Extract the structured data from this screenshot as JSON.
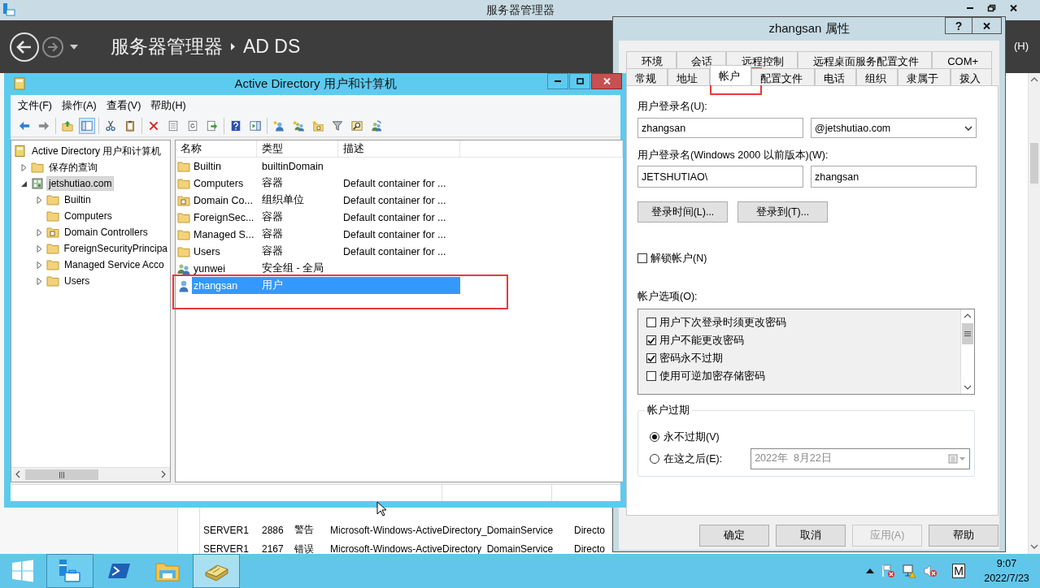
{
  "server_manager": {
    "title": "服务器管理器",
    "breadcrumb": [
      "服务器管理器",
      "AD DS"
    ],
    "menu_fragment": "(H)",
    "event_rows": [
      {
        "cells": [
          "SERVER1",
          "2886",
          "警告",
          "Microsoft-Windows-ActiveDirectory_DomainService",
          "Directo"
        ]
      },
      {
        "cells": [
          "SERVER1",
          "2167",
          "错误",
          "Microsoft-Windows-ActiveDirectory_DomainService",
          "Directo"
        ]
      }
    ]
  },
  "aduc": {
    "title": "Active Directory 用户和计算机",
    "menu": [
      "文件(F)",
      "操作(A)",
      "查看(V)",
      "帮助(H)"
    ],
    "toolbar": [
      [
        {
          "kind": "back",
          "pressed": false
        },
        {
          "kind": "forward",
          "pressed": false
        }
      ],
      [
        {
          "kind": "up",
          "pressed": false
        },
        {
          "kind": "tree",
          "pressed": true
        }
      ],
      [
        {
          "kind": "cut",
          "pressed": false
        },
        {
          "kind": "paste",
          "pressed": false
        }
      ],
      [
        {
          "kind": "delete",
          "pressed": false
        },
        {
          "kind": "properties",
          "pressed": false
        },
        {
          "kind": "refresh",
          "pressed": false
        },
        {
          "kind": "export",
          "pressed": false
        }
      ],
      [
        {
          "kind": "help",
          "pressed": false
        },
        {
          "kind": "action",
          "pressed": false
        }
      ],
      [
        {
          "kind": "newuser",
          "pressed": false
        },
        {
          "kind": "newgroup",
          "pressed": false
        },
        {
          "kind": "newou",
          "pressed": false
        },
        {
          "kind": "filter",
          "pressed": false
        },
        {
          "kind": "find",
          "pressed": false
        },
        {
          "kind": "delegate",
          "pressed": false
        }
      ]
    ],
    "tree": [
      {
        "label": "Active Directory 用户和计算机",
        "kind": "console",
        "selected": false,
        "children": [
          {
            "label": "保存的查询",
            "kind": "folder",
            "expanded": false,
            "selected": false
          },
          {
            "label": "jetshutiao.com",
            "kind": "domain",
            "expanded": true,
            "selected": true,
            "children": [
              {
                "label": "Builtin",
                "kind": "folder",
                "expanded": false,
                "selected": false
              },
              {
                "label": "Computers",
                "kind": "folder",
                "selected": false
              },
              {
                "label": "Domain Controllers",
                "kind": "ou",
                "expanded": false,
                "selected": false
              },
              {
                "label": "ForeignSecurityPrincipa",
                "kind": "folder",
                "expanded": false,
                "selected": false
              },
              {
                "label": "Managed Service Acco",
                "kind": "folder",
                "expanded": false,
                "selected": false
              },
              {
                "label": "Users",
                "kind": "folder",
                "expanded": false,
                "selected": false
              }
            ]
          }
        ]
      }
    ],
    "columns": [
      "名称",
      "类型",
      "描述"
    ],
    "rows": [
      {
        "kind": "folder",
        "name": "Builtin",
        "type": "builtinDomain",
        "selected": false,
        "highlighted": false
      },
      {
        "kind": "folder",
        "name": "Computers",
        "type": "容器",
        "description": "Default container for ...",
        "selected": false,
        "highlighted": false
      },
      {
        "kind": "ou",
        "name": "Domain Co...",
        "type": "组织单位",
        "description": "Default container for ...",
        "selected": false,
        "highlighted": false
      },
      {
        "kind": "folder",
        "name": "ForeignSec...",
        "type": "容器",
        "description": "Default container for ...",
        "selected": false,
        "highlighted": false
      },
      {
        "kind": "folder",
        "name": "Managed S...",
        "type": "容器",
        "description": "Default container for ...",
        "selected": false,
        "highlighted": false
      },
      {
        "kind": "folder",
        "name": "Users",
        "type": "容器",
        "description": "Default container for ...",
        "selected": false,
        "highlighted": false
      },
      {
        "kind": "group",
        "name": "yunwei",
        "type": "安全组 - 全局",
        "selected": false,
        "highlighted": false
      },
      {
        "kind": "user",
        "name": "zhangsan",
        "type": "用户",
        "selected": true,
        "highlighted": true
      }
    ]
  },
  "dialog": {
    "title": "zhangsan 属性",
    "help_glyph": "?",
    "tab_rows": [
      [
        {
          "label": "环境",
          "selected": false,
          "highlighted": false
        },
        {
          "label": "会话",
          "selected": false,
          "highlighted": false
        },
        {
          "label": "远程控制",
          "selected": false,
          "highlighted": false
        },
        {
          "label": "远程桌面服务配置文件",
          "selected": false,
          "highlighted": false
        },
        {
          "label": "COM+",
          "selected": false,
          "highlighted": false
        }
      ],
      [
        {
          "label": "常规",
          "selected": false,
          "highlighted": false
        },
        {
          "label": "地址",
          "selected": false,
          "highlighted": false
        },
        {
          "label": "帐户",
          "selected": true,
          "highlighted": true
        },
        {
          "label": "配置文件",
          "selected": false,
          "highlighted": false
        },
        {
          "label": "电话",
          "selected": false,
          "highlighted": false
        },
        {
          "label": "组织",
          "selected": false,
          "highlighted": false
        },
        {
          "label": "隶属于",
          "selected": false,
          "highlighted": false
        },
        {
          "label": "拨入",
          "selected": false,
          "highlighted": false
        }
      ]
    ],
    "logon_label": "用户登录名(U):",
    "logon_name": "zhangsan",
    "upn_suffix": "@jetshutiao.com",
    "legacy_label": "用户登录名(Windows 2000 以前版本)(W):",
    "legacy_domain": "JETSHUTIAO\\",
    "legacy_name": "zhangsan",
    "action_buttons": [
      "登录时间(L)...",
      "登录到(T)..."
    ],
    "unlock": {
      "label": "解锁帐户(N)",
      "checked": false
    },
    "options_label": "帐户选项(O):",
    "options": [
      {
        "label": "用户下次登录时须更改密码",
        "checked": false
      },
      {
        "label": "用户不能更改密码",
        "checked": true
      },
      {
        "label": "密码永不过期",
        "checked": true
      },
      {
        "label": "使用可逆加密存储密码",
        "checked": false
      }
    ],
    "expiry": {
      "legend": "帐户过期",
      "choices": [
        {
          "label": "永不过期(V)",
          "selected": true
        },
        {
          "label": "在这之后(E):",
          "selected": false
        }
      ],
      "date": "2022年  8月22日",
      "date_disabled": true
    },
    "buttons": [
      {
        "label": "确定",
        "disabled": false
      },
      {
        "label": "取消",
        "disabled": false
      },
      {
        "label": "应用(A)",
        "disabled": true
      },
      {
        "label": "帮助",
        "disabled": false
      }
    ]
  },
  "taskbar": {
    "apps": [
      {
        "kind": "server-manager",
        "running": true,
        "selected": false
      },
      {
        "kind": "powershell",
        "running": false,
        "selected": false
      },
      {
        "kind": "explorer",
        "running": false,
        "selected": false
      },
      {
        "kind": "aduc",
        "running": true,
        "selected": true
      }
    ],
    "tray": [
      {
        "kind": "flag"
      },
      {
        "kind": "network"
      },
      {
        "kind": "speaker"
      }
    ],
    "input_indicator": "M",
    "time": "9:07",
    "date": "2022/7/23"
  }
}
